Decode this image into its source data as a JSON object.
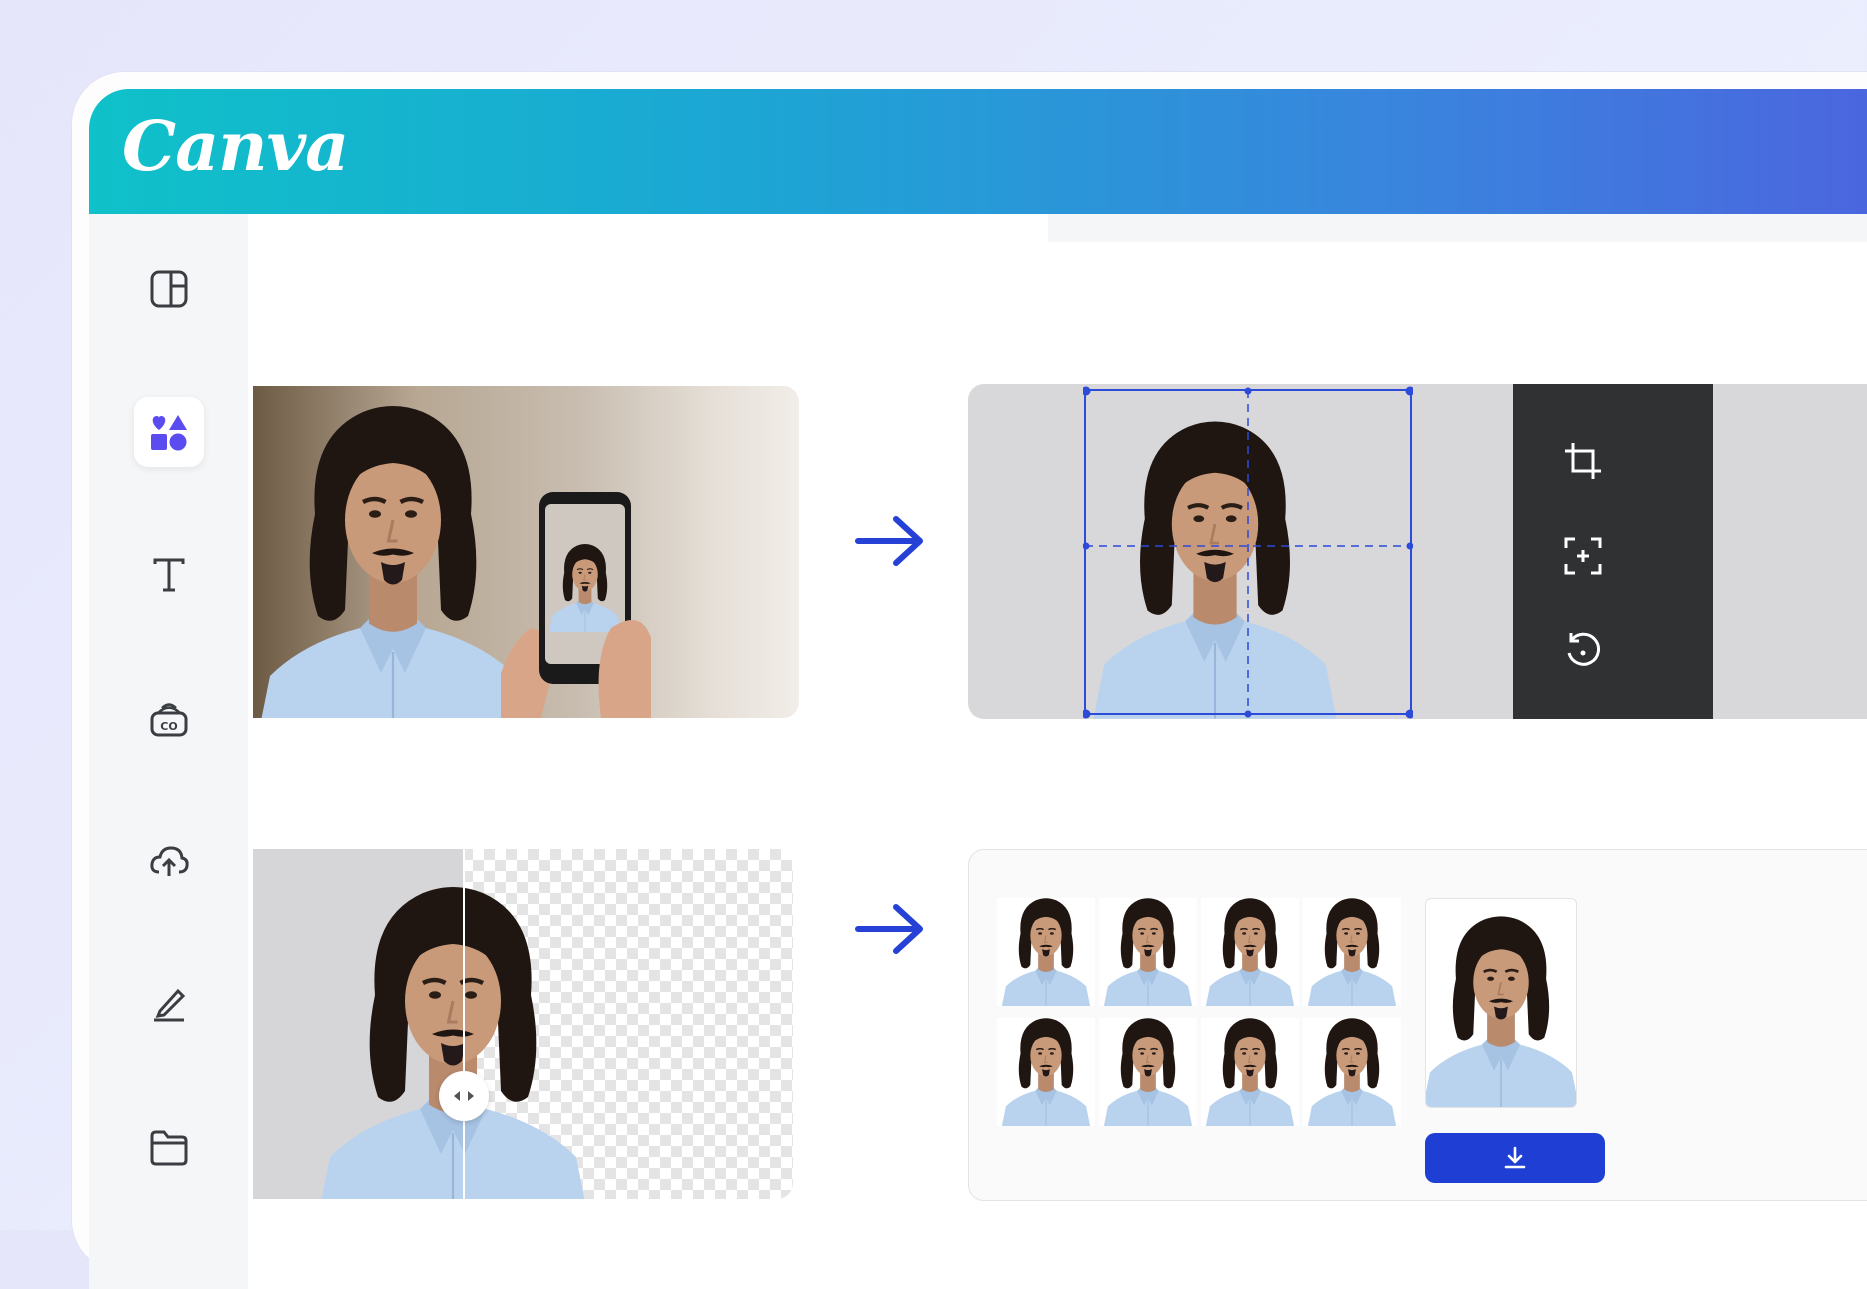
{
  "app": {
    "logo_text": "Canva",
    "brand_gradient": [
      "#0fc1c9",
      "#4d62df"
    ]
  },
  "sidebar": {
    "items": [
      {
        "icon": "layout-icon",
        "active": false
      },
      {
        "icon": "elements-icon",
        "active": true
      },
      {
        "icon": "text-icon",
        "active": false
      },
      {
        "icon": "brand-icon",
        "active": false
      },
      {
        "icon": "uploads-icon",
        "active": false
      },
      {
        "icon": "draw-icon",
        "active": false
      },
      {
        "icon": "projects-icon",
        "active": false
      }
    ]
  },
  "steps": [
    {
      "name": "take-photo",
      "description_visible": false
    },
    {
      "name": "crop-photo",
      "tools": [
        "crop-icon",
        "focus-icon",
        "rotate-icon"
      ]
    },
    {
      "name": "remove-background"
    },
    {
      "name": "print-sheet",
      "grid": {
        "rows": 2,
        "cols": 4
      },
      "download_icon": "download-icon"
    }
  ],
  "colors": {
    "accent": "#1f3fd4",
    "arrow": "#2541d6",
    "crop_guide": "#2c4bd8",
    "toolbar": "#2f3133"
  }
}
